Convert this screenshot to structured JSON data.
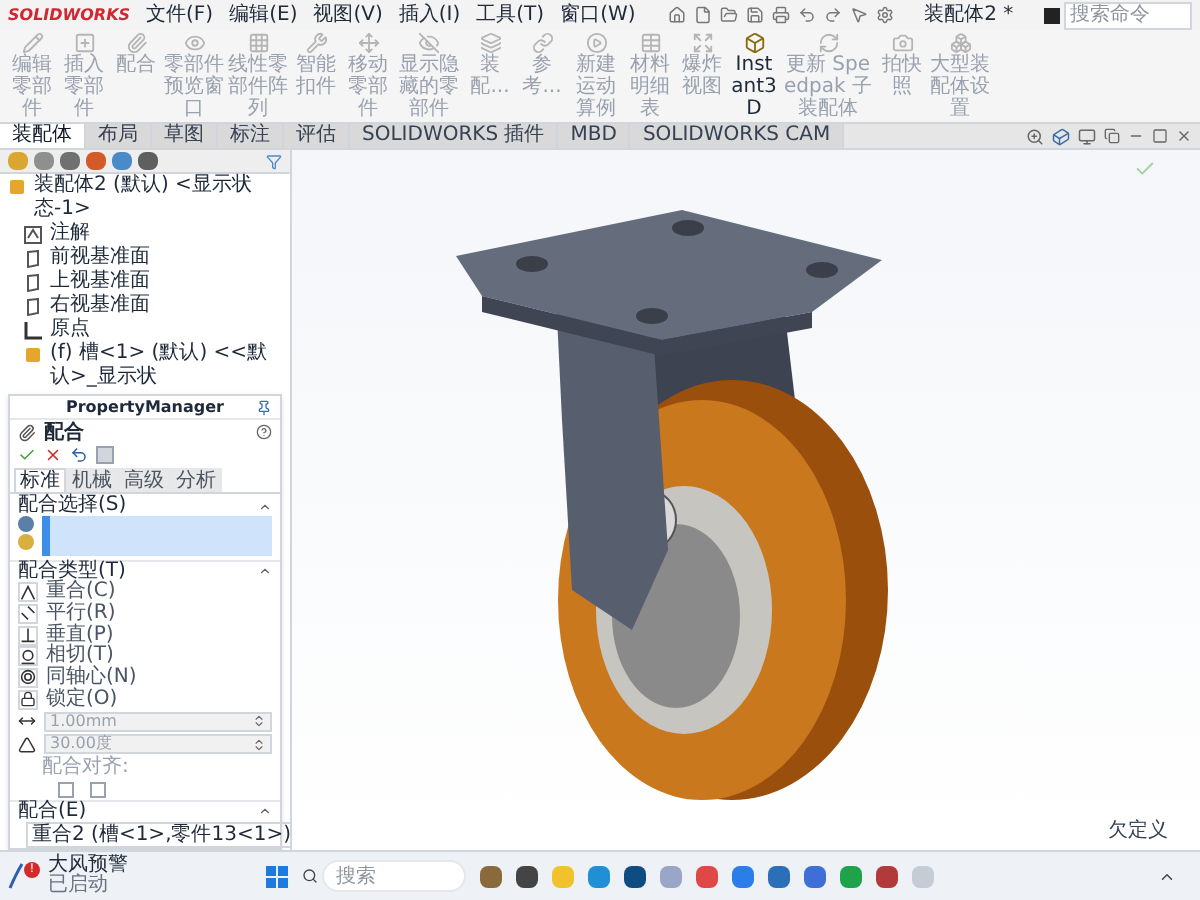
{
  "title_bar": {
    "logo": "SOLIDWORKS",
    "menus": [
      "文件(F)",
      "编辑(E)",
      "视图(V)",
      "插入(I)",
      "工具(T)",
      "窗口(W)"
    ],
    "document": "装配体2 *",
    "search": {
      "placeholder": "搜索命令"
    }
  },
  "ribbon": [
    {
      "label": "编辑零部件",
      "disabled": true
    },
    {
      "label": "插入零部件",
      "disabled": true
    },
    {
      "label": "配合",
      "disabled": true
    },
    {
      "label": "零部件预览窗口",
      "disabled": true
    },
    {
      "label": "线性零部件阵列",
      "disabled": true
    },
    {
      "label": "智能扣件",
      "disabled": true
    },
    {
      "label": "移动零部件",
      "disabled": true
    },
    {
      "label": "显示隐藏的零部件",
      "disabled": true
    },
    {
      "label": "装配...",
      "disabled": true
    },
    {
      "label": "参考...",
      "disabled": true
    },
    {
      "label": "新建运动算例",
      "disabled": true
    },
    {
      "label": "材料明细表",
      "disabled": true
    },
    {
      "label": "爆炸视图",
      "disabled": true
    },
    {
      "label": "Instant3D",
      "disabled": false
    },
    {
      "label": "更新 Speedpak 子装配体",
      "disabled": true
    },
    {
      "label": "拍快照",
      "disabled": true
    },
    {
      "label": "大型装配体设置",
      "disabled": true
    }
  ],
  "tabs": [
    {
      "label": "装配体",
      "selected": true
    },
    {
      "label": "布局",
      "selected": false
    },
    {
      "label": "草图",
      "selected": false
    },
    {
      "label": "标注",
      "selected": false
    },
    {
      "label": "评估",
      "selected": false
    },
    {
      "label": "SOLIDWORKS 插件",
      "selected": false
    },
    {
      "label": "MBD",
      "selected": false
    },
    {
      "label": "SOLIDWORKS CAM",
      "selected": false
    }
  ],
  "feature_tree": {
    "label": "装配体2 (默认) <显示状态-1>",
    "children": [
      {
        "kind": "annotation",
        "label": "注解"
      },
      {
        "kind": "plane",
        "label": "前视基准面"
      },
      {
        "kind": "plane",
        "label": "上视基准面"
      },
      {
        "kind": "plane",
        "label": "右视基准面"
      },
      {
        "kind": "origin",
        "label": "原点"
      },
      {
        "kind": "part",
        "label": "(f) 槽<1> (默认) <<默认>_显示状"
      }
    ]
  },
  "property_manager": {
    "title": "PropertyManager",
    "feature": "配合",
    "tabs": [
      {
        "label": "标准",
        "selected": true
      },
      {
        "label": "机械",
        "selected": false
      },
      {
        "label": "高级",
        "selected": false
      },
      {
        "label": "分析",
        "selected": false
      }
    ],
    "selection_heading": "配合选择(S)",
    "type_heading": "配合类型(T)",
    "mate_types": [
      {
        "kind": "coincident",
        "label": "重合(C)"
      },
      {
        "kind": "parallel",
        "label": "平行(R)"
      },
      {
        "kind": "perpendicular",
        "label": "垂直(P)"
      },
      {
        "kind": "tangent",
        "label": "相切(T)"
      },
      {
        "kind": "concentric",
        "label": "同轴心(N)"
      },
      {
        "kind": "lock",
        "label": "锁定(O)"
      }
    ],
    "distance": {
      "value": "1.00mm"
    },
    "angle": {
      "value": "30.00度"
    },
    "alignment_label": "配合对齐:",
    "mates_heading": "配合(E)",
    "mates": [
      "重合2 (槽<1>,零件13<1>)"
    ]
  },
  "status": "欠定义",
  "taskbar": {
    "notification": {
      "badge": "!",
      "title": "大风预警",
      "subtitle": "已启动"
    },
    "search": {
      "placeholder": "搜索"
    }
  }
}
